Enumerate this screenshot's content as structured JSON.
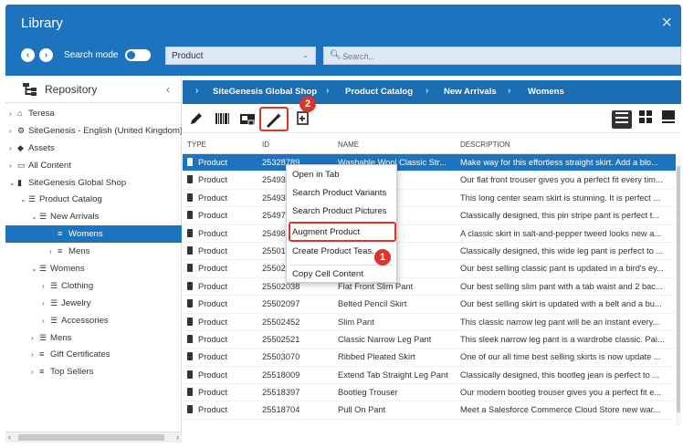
{
  "window": {
    "title": "Library",
    "close_glyph": "×"
  },
  "search": {
    "mode_label": "Search mode",
    "type_value": "Product",
    "placeholder": "Search..."
  },
  "repository": {
    "label": "Repository",
    "tree": [
      {
        "label": "Teresa",
        "arrow": "›",
        "icon": "home-icon",
        "glyph": "⌂"
      },
      {
        "label": "SiteGenesis - English (United Kingdom)",
        "arrow": "›",
        "icon": "settings-icon",
        "glyph": "⚙"
      },
      {
        "label": "Assets",
        "arrow": "›",
        "icon": "assets-icon",
        "glyph": "◆"
      },
      {
        "label": "All Content",
        "arrow": "›",
        "icon": "folder-icon",
        "glyph": "▭"
      },
      {
        "label": "SiteGenesis Global Shop",
        "arrow": "⌄",
        "icon": "store-icon",
        "glyph": "▮"
      },
      {
        "label": "Product Catalog",
        "arrow": "⌄",
        "icon": "catalog-icon",
        "glyph": "☰"
      },
      {
        "label": "New Arrivals",
        "arrow": "⌄",
        "icon": "category-icon",
        "glyph": "☰"
      },
      {
        "label": "Womens",
        "arrow": "",
        "icon": "category-icon",
        "glyph": "≡",
        "selected": true
      },
      {
        "label": "Mens",
        "arrow": "›",
        "icon": "category-icon",
        "glyph": "≡"
      },
      {
        "label": "Womens",
        "arrow": "⌄",
        "icon": "category-icon",
        "glyph": "☰"
      },
      {
        "label": "Clothing",
        "arrow": "›",
        "icon": "category-icon",
        "glyph": "☰"
      },
      {
        "label": "Jewelry",
        "arrow": "›",
        "icon": "category-icon",
        "glyph": "☰"
      },
      {
        "label": "Accessories",
        "arrow": "›",
        "icon": "category-icon",
        "glyph": "☰"
      },
      {
        "label": "Mens",
        "arrow": "›",
        "icon": "category-icon",
        "glyph": "☰"
      },
      {
        "label": "Gift Certificates",
        "arrow": "›",
        "icon": "category-icon",
        "glyph": "≡"
      },
      {
        "label": "Top Sellers",
        "arrow": "›",
        "icon": "category-icon",
        "glyph": "≡"
      }
    ]
  },
  "breadcrumb": {
    "sep": "›",
    "items": [
      "SiteGenesis Global Shop",
      "Product Catalog",
      "New Arrivals",
      "Womens"
    ]
  },
  "toolbar": {
    "badge_2": "2",
    "badge_1": "1"
  },
  "table": {
    "headers": {
      "type": "TYPE",
      "id": "ID",
      "name": "NAME",
      "description": "DESCRIPTION"
    },
    "rows": [
      {
        "type": "Product",
        "id": "25328789",
        "name": "Washable Wool Classic Str...",
        "desc": "Make way for this effortless straight skirt. Add a blo...",
        "selected": true
      },
      {
        "type": "Product",
        "id": "25493...",
        "name": "...sic Pant",
        "desc": "Our flat front trouser gives you a perfect fit every tim..."
      },
      {
        "type": "Product",
        "id": "25493...",
        "name": "...eam Skirt",
        "desc": "This long center seam skirt is stunning. It is perfect ..."
      },
      {
        "type": "Product",
        "id": "25497...",
        "name": "...sic Pant",
        "desc": "Classically designed, this pin stripe pant is perfect t..."
      },
      {
        "type": "Product",
        "id": "25498...",
        "name": "...cil Skirt",
        "desc": "A classic skirt in salt-and-pepper tweed looks new a..."
      },
      {
        "type": "Product",
        "id": "25501...",
        "name": "",
        "desc": "Classically designed, this wide leg pant is perfect to ..."
      },
      {
        "type": "Product",
        "id": "25502...",
        "name": "...Pant",
        "desc": "Our best selling classic pant is updated in a bird's ey..."
      },
      {
        "type": "Product",
        "id": "25502038",
        "name": "Flat Front Slim Pant",
        "desc": "Our best selling slim pant with a tab waist and 2 bac..."
      },
      {
        "type": "Product",
        "id": "25502097",
        "name": "Belted Pencil Skirt",
        "desc": "Our best selling skirt is updated with a belt and a bu..."
      },
      {
        "type": "Product",
        "id": "25502452",
        "name": "Slim Pant",
        "desc": "This classic narrow leg pant will be an instant every..."
      },
      {
        "type": "Product",
        "id": "25502521",
        "name": "Classic Narrow Leg Pant",
        "desc": "This sleek narrow leg pant is a wardrobe classic. Pai..."
      },
      {
        "type": "Product",
        "id": "25503070",
        "name": "Ribbed Pleated Skirt",
        "desc": "One of our all time best selling skirts is now update ..."
      },
      {
        "type": "Product",
        "id": "25518009",
        "name": "Extend Tab Straight Leg Pant",
        "desc": "Classically designed, this bootleg jean is perfect to ..."
      },
      {
        "type": "Product",
        "id": "25518397",
        "name": "Bootleg Trouser",
        "desc": "Our modern bootleg trouser gives you a perfect fit e..."
      },
      {
        "type": "Product",
        "id": "25518704",
        "name": "Pull On Pant",
        "desc": "Meet a Salesforce Commerce Cloud Store new war..."
      }
    ]
  },
  "context_menu": {
    "items": [
      "Open in Tab",
      "Search Product Variants",
      "Search Product Pictures",
      "Augment Product",
      "Create Product Teas...",
      "Copy Cell Content"
    ]
  },
  "colors": {
    "accent": "#1e73be",
    "highlight": "#d9362b"
  }
}
